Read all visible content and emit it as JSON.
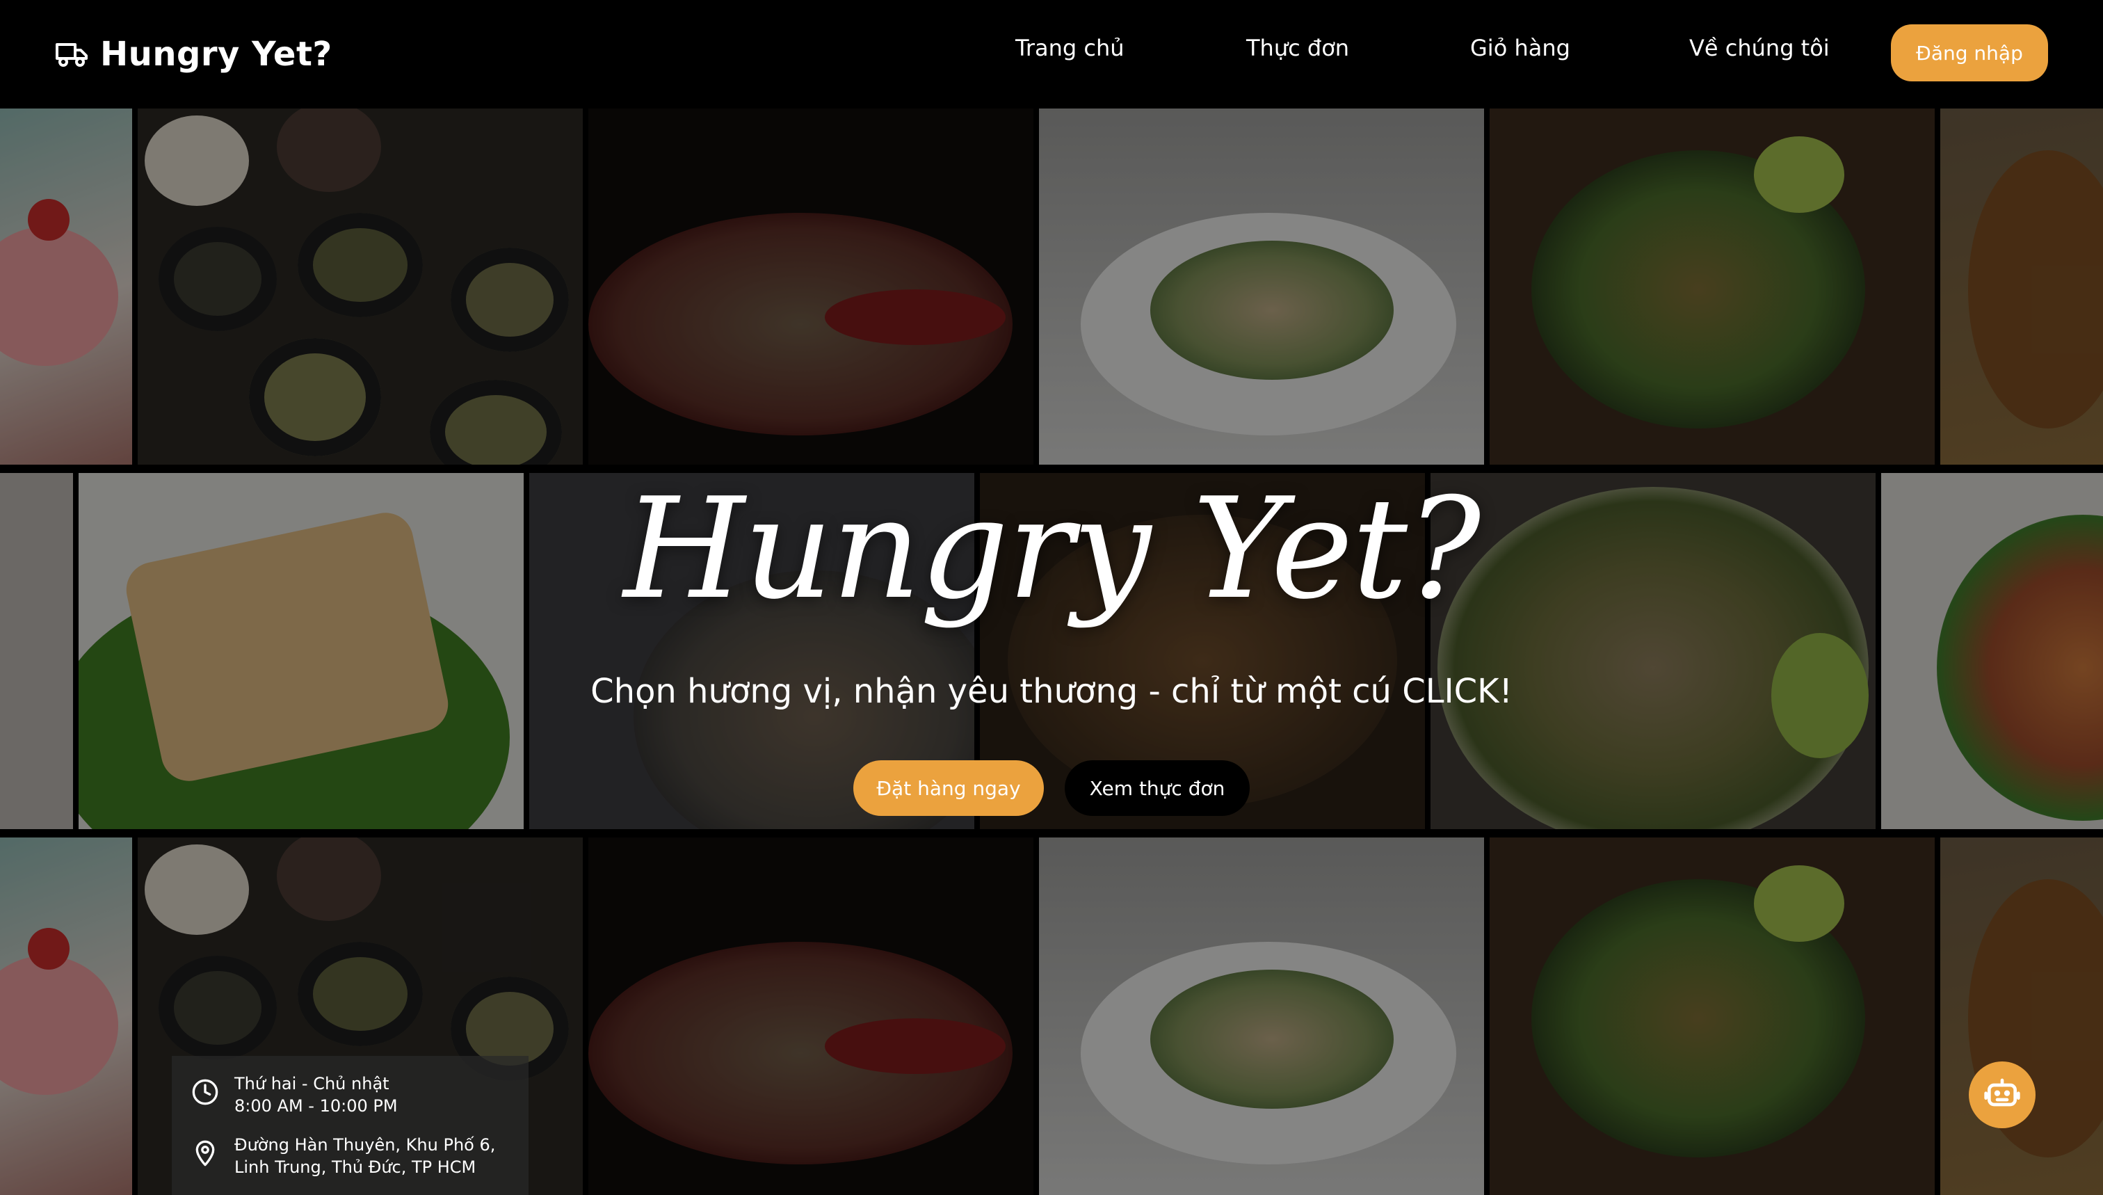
{
  "brand": {
    "name": "Hungry Yet?",
    "icon": "delivery-truck-icon"
  },
  "nav": {
    "items": [
      {
        "label": "Trang chủ"
      },
      {
        "label": "Thực đơn"
      },
      {
        "label": "Giỏ hàng"
      },
      {
        "label": "Về chúng tôi"
      }
    ],
    "login_label": "Đăng nhập"
  },
  "hero": {
    "title": "Hungry Yet?",
    "subtitle": "Chọn hương vị, nhận yêu thương - chỉ từ một cú CLICK!",
    "order_button": "Đặt hàng ngay",
    "menu_button": "Xem thực đơn"
  },
  "info": {
    "hours_days": "Thứ hai - Chủ nhật",
    "hours_time": "8:00 AM - 10:00 PM",
    "address_line1": "Đường Hàn Thuyên, Khu Phố 6,",
    "address_line2": "Linh Trung, Thủ Đức, TP HCM"
  },
  "icons": {
    "clock": "clock-icon",
    "location": "location-pin-icon",
    "chatbot": "chatbot-icon"
  },
  "colors": {
    "accent": "#EBA23E",
    "header_bg": "#000000",
    "text": "#FFFFFF"
  }
}
